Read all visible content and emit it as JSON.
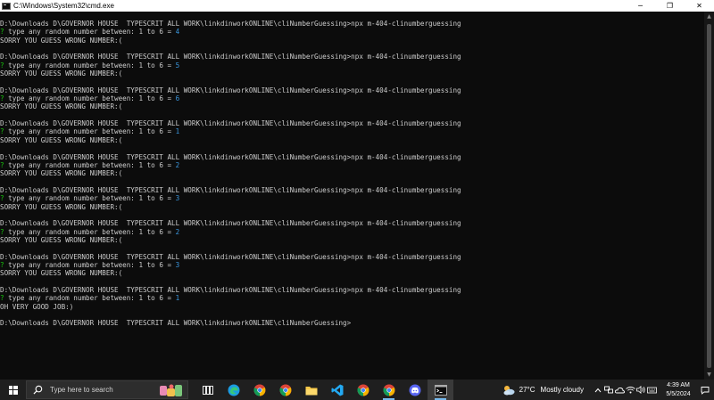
{
  "window": {
    "title": "C:\\Windows\\System32\\cmd.exe",
    "controls": {
      "minimize": "─",
      "maximize": "❐",
      "close": "✕"
    }
  },
  "console": {
    "lines": [
      {
        "type": "prompt",
        "text": "D:\\Downloads D\\GOVERNOR HOUSE  TYPESCRIT ALL WORK\\linkdinworkONLINE\\cliNumberGuessing>npx m-404-clinumberguessing"
      },
      {
        "type": "question",
        "text": "type any random number between: 1 to 6 = ",
        "answer": "4"
      },
      {
        "type": "output",
        "text": "SORRY YOU GUESS WRONG NUMBER:("
      },
      {
        "type": "blank",
        "text": ""
      },
      {
        "type": "prompt",
        "text": "D:\\Downloads D\\GOVERNOR HOUSE  TYPESCRIT ALL WORK\\linkdinworkONLINE\\cliNumberGuessing>npx m-404-clinumberguessing"
      },
      {
        "type": "question",
        "text": "type any random number between: 1 to 6 = ",
        "answer": "5"
      },
      {
        "type": "output",
        "text": "SORRY YOU GUESS WRONG NUMBER:("
      },
      {
        "type": "blank",
        "text": ""
      },
      {
        "type": "prompt",
        "text": "D:\\Downloads D\\GOVERNOR HOUSE  TYPESCRIT ALL WORK\\linkdinworkONLINE\\cliNumberGuessing>npx m-404-clinumberguessing"
      },
      {
        "type": "question",
        "text": "type any random number between: 1 to 6 = ",
        "answer": "6"
      },
      {
        "type": "output",
        "text": "SORRY YOU GUESS WRONG NUMBER:("
      },
      {
        "type": "blank",
        "text": ""
      },
      {
        "type": "prompt",
        "text": "D:\\Downloads D\\GOVERNOR HOUSE  TYPESCRIT ALL WORK\\linkdinworkONLINE\\cliNumberGuessing>npx m-404-clinumberguessing"
      },
      {
        "type": "question",
        "text": "type any random number between: 1 to 6 = ",
        "answer": "1"
      },
      {
        "type": "output",
        "text": "SORRY YOU GUESS WRONG NUMBER:("
      },
      {
        "type": "blank",
        "text": ""
      },
      {
        "type": "prompt",
        "text": "D:\\Downloads D\\GOVERNOR HOUSE  TYPESCRIT ALL WORK\\linkdinworkONLINE\\cliNumberGuessing>npx m-404-clinumberguessing"
      },
      {
        "type": "question",
        "text": "type any random number between: 1 to 6 = ",
        "answer": "2"
      },
      {
        "type": "output",
        "text": "SORRY YOU GUESS WRONG NUMBER:("
      },
      {
        "type": "blank",
        "text": ""
      },
      {
        "type": "prompt",
        "text": "D:\\Downloads D\\GOVERNOR HOUSE  TYPESCRIT ALL WORK\\linkdinworkONLINE\\cliNumberGuessing>npx m-404-clinumberguessing"
      },
      {
        "type": "question",
        "text": "type any random number between: 1 to 6 = ",
        "answer": "3"
      },
      {
        "type": "output",
        "text": "SORRY YOU GUESS WRONG NUMBER:("
      },
      {
        "type": "blank",
        "text": ""
      },
      {
        "type": "prompt",
        "text": "D:\\Downloads D\\GOVERNOR HOUSE  TYPESCRIT ALL WORK\\linkdinworkONLINE\\cliNumberGuessing>npx m-404-clinumberguessing"
      },
      {
        "type": "question",
        "text": "type any random number between: 1 to 6 = ",
        "answer": "2"
      },
      {
        "type": "output",
        "text": "SORRY YOU GUESS WRONG NUMBER:("
      },
      {
        "type": "blank",
        "text": ""
      },
      {
        "type": "prompt",
        "text": "D:\\Downloads D\\GOVERNOR HOUSE  TYPESCRIT ALL WORK\\linkdinworkONLINE\\cliNumberGuessing>npx m-404-clinumberguessing"
      },
      {
        "type": "question",
        "text": "type any random number between: 1 to 6 = ",
        "answer": "3"
      },
      {
        "type": "output",
        "text": "SORRY YOU GUESS WRONG NUMBER:("
      },
      {
        "type": "blank",
        "text": ""
      },
      {
        "type": "prompt",
        "text": "D:\\Downloads D\\GOVERNOR HOUSE  TYPESCRIT ALL WORK\\linkdinworkONLINE\\cliNumberGuessing>npx m-404-clinumberguessing"
      },
      {
        "type": "question",
        "text": "type any random number between: 1 to 6 = ",
        "answer": "1"
      },
      {
        "type": "output",
        "text": "OH VERY GOOD JOB:)"
      },
      {
        "type": "blank",
        "text": ""
      },
      {
        "type": "prompt",
        "text": "D:\\Downloads D\\GOVERNOR HOUSE  TYPESCRIT ALL WORK\\linkdinworkONLINE\\cliNumberGuessing>"
      }
    ],
    "question_mark": "?",
    "colors": {
      "text": "#cccccc",
      "question_mark": "#16c60c",
      "answer": "#3a96dd",
      "background": "#0c0c0c"
    }
  },
  "taskbar": {
    "search_placeholder": "Type here to search",
    "apps": [
      {
        "name": "task-view-icon",
        "running": false,
        "active": false
      },
      {
        "name": "edge-icon",
        "running": false,
        "active": false
      },
      {
        "name": "chrome-icon",
        "running": false,
        "active": false
      },
      {
        "name": "chrome-icon",
        "running": false,
        "active": false
      },
      {
        "name": "file-explorer-icon",
        "running": false,
        "active": false
      },
      {
        "name": "vscode-icon",
        "running": false,
        "active": false
      },
      {
        "name": "chrome-icon",
        "running": false,
        "active": false
      },
      {
        "name": "chrome-icon",
        "running": true,
        "active": false
      },
      {
        "name": "discord-icon",
        "running": false,
        "active": false
      },
      {
        "name": "cmd-icon",
        "running": true,
        "active": true
      }
    ],
    "weather": {
      "temp": "27°C",
      "condition": "Mostly cloudy"
    },
    "tray_icons": [
      "chevron-up-icon",
      "network-icon",
      "onedrive-icon",
      "wifi-icon",
      "volume-icon",
      "keyboard-icon"
    ],
    "clock": {
      "time": "4:39 AM",
      "date": "5/5/2024"
    }
  }
}
